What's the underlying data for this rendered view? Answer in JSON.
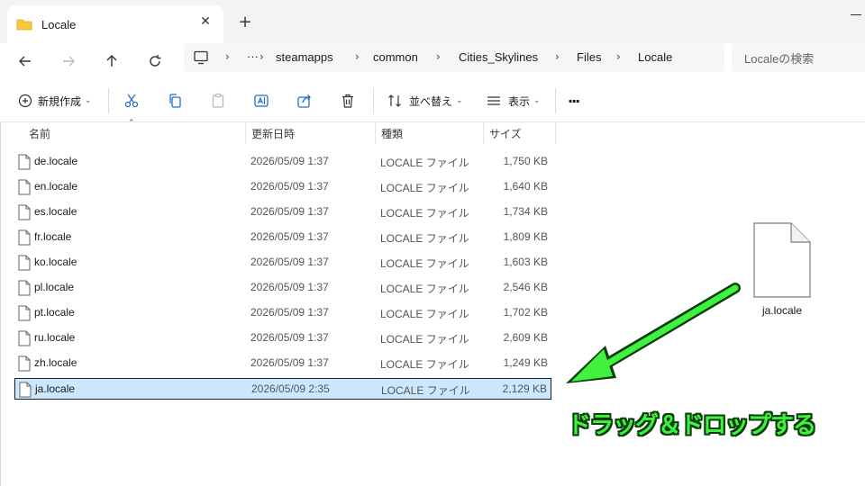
{
  "tab": {
    "title": "Locale",
    "close": "✕",
    "new": "+"
  },
  "breadcrumb": {
    "overflow": "···",
    "items": [
      "steamapps",
      "common",
      "Cities_Skylines",
      "Files",
      "Locale"
    ]
  },
  "search": {
    "placeholder": "Localeの検索"
  },
  "toolbar": {
    "new_label": "新規作成",
    "sort_label": "並べ替え",
    "view_label": "表示",
    "more": "···"
  },
  "columns": {
    "name": "名前",
    "date": "更新日時",
    "type": "種類",
    "size": "サイズ"
  },
  "files": [
    {
      "name": "de.locale",
      "date": "2026/05/09 1:37",
      "type": "LOCALE ファイル",
      "size": "1,750 KB"
    },
    {
      "name": "en.locale",
      "date": "2026/05/09 1:37",
      "type": "LOCALE ファイル",
      "size": "1,640 KB"
    },
    {
      "name": "es.locale",
      "date": "2026/05/09 1:37",
      "type": "LOCALE ファイル",
      "size": "1,734 KB"
    },
    {
      "name": "fr.locale",
      "date": "2026/05/09 1:37",
      "type": "LOCALE ファイル",
      "size": "1,809 KB"
    },
    {
      "name": "ko.locale",
      "date": "2026/05/09 1:37",
      "type": "LOCALE ファイル",
      "size": "1,603 KB"
    },
    {
      "name": "pl.locale",
      "date": "2026/05/09 1:37",
      "type": "LOCALE ファイル",
      "size": "2,546 KB"
    },
    {
      "name": "pt.locale",
      "date": "2026/05/09 1:37",
      "type": "LOCALE ファイル",
      "size": "1,702 KB"
    },
    {
      "name": "ru.locale",
      "date": "2026/05/09 1:37",
      "type": "LOCALE ファイル",
      "size": "2,609 KB"
    },
    {
      "name": "zh.locale",
      "date": "2026/05/09 1:37",
      "type": "LOCALE ファイル",
      "size": "1,249 KB"
    },
    {
      "name": "ja.locale",
      "date": "2026/05/09 2:35",
      "type": "LOCALE ファイル",
      "size": "2,129 KB",
      "selected": true
    }
  ],
  "dragged_file": {
    "name": "ja.locale"
  },
  "callout": "ドラッグ＆ドロップする",
  "colors": {
    "accent_selected": "#cce8ff",
    "callout_green": "#3ef23e",
    "folder_yellow": "#f8c73e"
  }
}
